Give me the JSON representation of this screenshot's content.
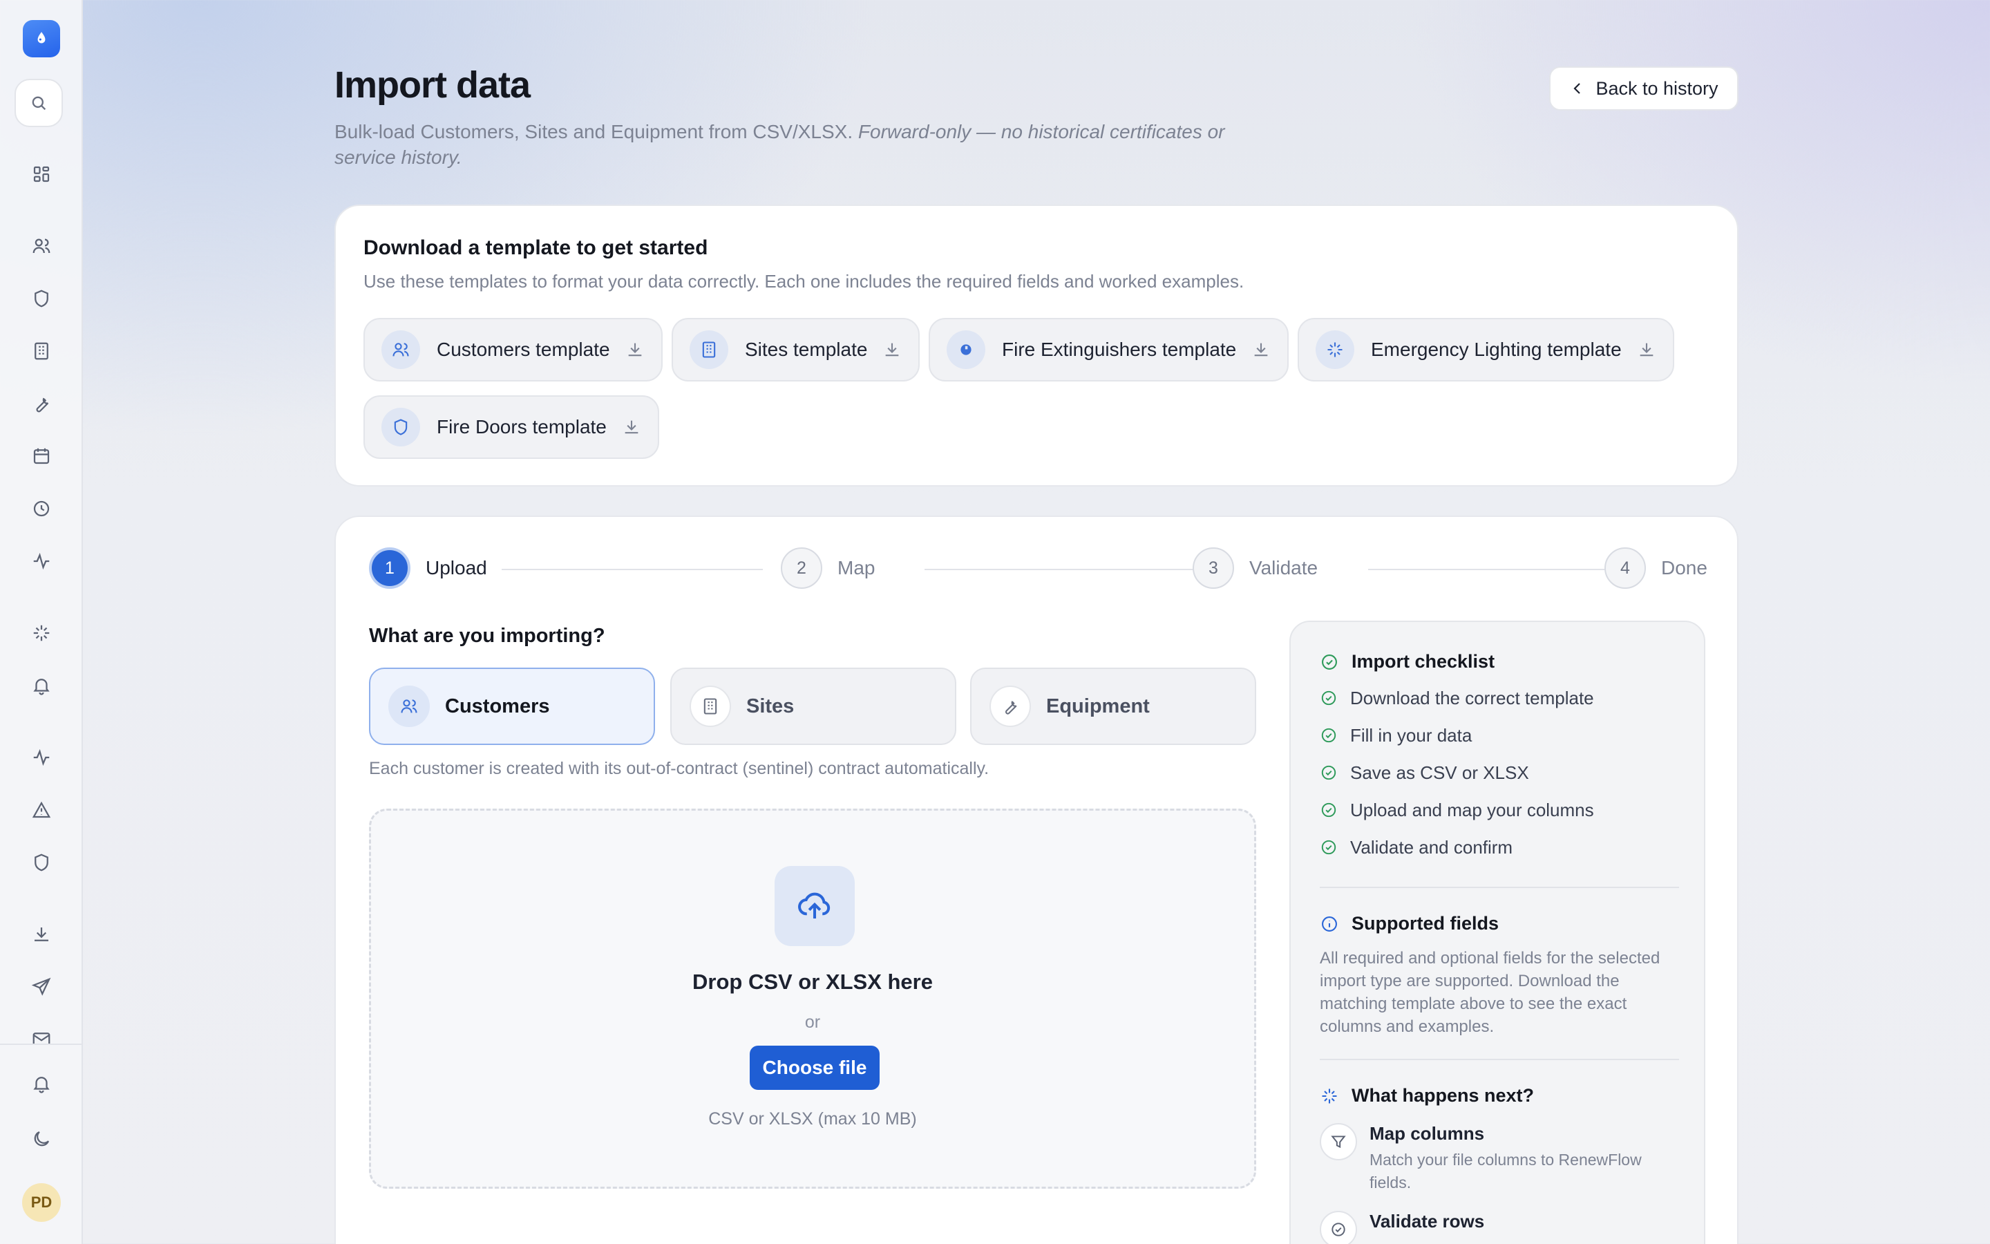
{
  "sidebar": {
    "logo_icon": "water-drop-icon",
    "search_icon": "search-icon",
    "nav_icons": [
      "dashboard-icon",
      "users-icon",
      "shield-icon",
      "building-icon",
      "wrench-icon",
      "calendar-icon",
      "clock-icon",
      "activity-icon",
      "sparkle-icon",
      "bell-icon",
      "activity-icon",
      "warning-icon",
      "shield-icon",
      "download-icon",
      "send-icon",
      "mail-icon"
    ],
    "bottom_icons": [
      "bell-icon",
      "moon-icon"
    ],
    "avatar_initials": "PD"
  },
  "header": {
    "title": "Import data",
    "subtitle": "Bulk-load Customers, Sites and Equipment from CSV/XLSX.",
    "subtitle_note": "Forward-only — no historical certificates or service history.",
    "back_label": "Back to history"
  },
  "templates": {
    "title": "Download a template to get started",
    "subtitle": "Use these templates to format your data correctly. Each one includes the required fields and worked examples.",
    "items": [
      {
        "label": "Customers template",
        "icon": "users-icon"
      },
      {
        "label": "Sites template",
        "icon": "building-icon"
      },
      {
        "label": "Fire Extinguishers template",
        "icon": "extinguisher-icon"
      },
      {
        "label": "Emergency Lighting template",
        "icon": "sparkle-icon"
      },
      {
        "label": "Fire Doors template",
        "icon": "shield-icon"
      }
    ]
  },
  "stepper": {
    "steps": [
      {
        "num": "1",
        "label": "Upload",
        "active": true
      },
      {
        "num": "2",
        "label": "Map",
        "active": false
      },
      {
        "num": "3",
        "label": "Validate",
        "active": false
      },
      {
        "num": "4",
        "label": "Done",
        "active": false
      }
    ]
  },
  "import_type": {
    "question": "What are you importing?",
    "options": [
      {
        "label": "Customers",
        "icon": "users-icon",
        "selected": true
      },
      {
        "label": "Sites",
        "icon": "building-icon",
        "selected": false
      },
      {
        "label": "Equipment",
        "icon": "wrench-icon",
        "selected": false
      }
    ],
    "note": "Each customer is created with its out-of-contract (sentinel) contract automatically."
  },
  "dropzone": {
    "icon": "cloud-upload-icon",
    "title": "Drop CSV or XLSX here",
    "or": "or",
    "button": "Choose file",
    "hint": "CSV or XLSX (max 10 MB)"
  },
  "panel": {
    "checklist_title": "Import checklist",
    "checklist": [
      "Download the correct template",
      "Fill in your data",
      "Save as CSV or XLSX",
      "Upload and map your columns",
      "Validate and confirm"
    ],
    "fields_title": "Supported fields",
    "fields_text": "All required and optional fields for the selected import type are supported. Download the matching template above to see the exact columns and examples.",
    "next_title": "What happens next?",
    "next": [
      {
        "title": "Map columns",
        "desc": "Match your file columns to RenewFlow fields.",
        "icon": "filter-icon"
      },
      {
        "title": "Validate rows",
        "desc": "",
        "icon": "check-circle-icon"
      }
    ]
  },
  "colors": {
    "accent": "#2a66d8",
    "success": "#2e9a5a",
    "muted_text": "#7c8292"
  }
}
